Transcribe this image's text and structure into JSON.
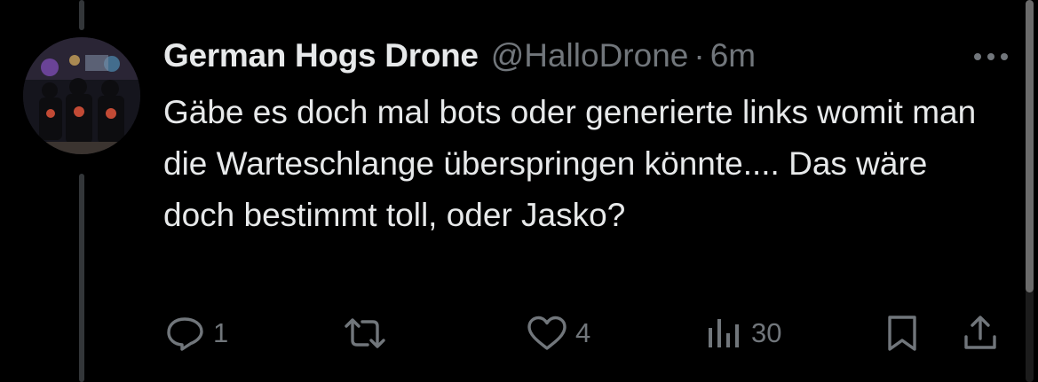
{
  "tweet": {
    "display_name": "German Hogs Drone",
    "handle": "@HalloDrone",
    "separator": "·",
    "time": "6m",
    "text": "Gäbe es doch mal bots oder generierte links womit man die Warteschlange überspringen könnte.... Das wäre doch bestimmt toll, oder Jasko?"
  },
  "actions": {
    "reply_count": "1",
    "like_count": "4",
    "views_count": "30"
  },
  "icons": {
    "more": "more-horizontal-icon",
    "reply": "reply-icon",
    "retweet": "retweet-icon",
    "like": "heart-icon",
    "views": "views-icon",
    "bookmark": "bookmark-icon",
    "share": "share-icon"
  },
  "colors": {
    "background": "#000000",
    "text": "#e7e9ea",
    "secondary": "#71767b",
    "thread_line": "#333639"
  }
}
